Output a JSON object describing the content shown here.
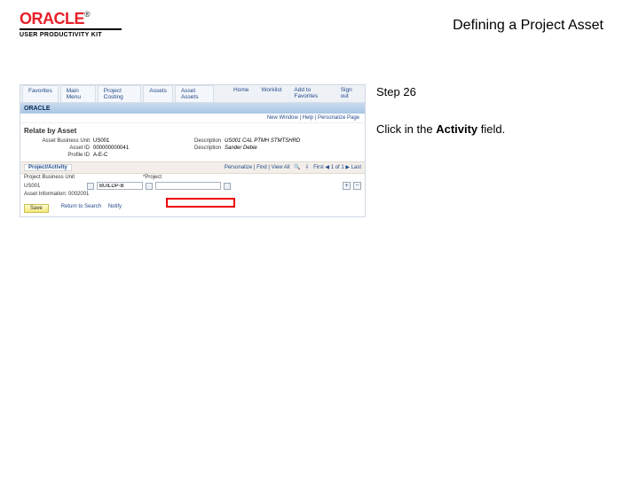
{
  "header": {
    "brand": "ORACLE",
    "brand_suffix": "®",
    "subbrand": "USER PRODUCTIVITY KIT",
    "doc_title": "Defining a Project Asset"
  },
  "instructions": {
    "step_label": "Step 26",
    "text_prefix": "Click in the ",
    "text_bold": "Activity",
    "text_suffix": " field."
  },
  "app": {
    "nav": [
      "Favorites",
      "Main Menu",
      "Project Costing",
      "Assets",
      "Asset Assets"
    ],
    "nav_right": [
      "Home",
      "Worklist",
      "Add to Favorites",
      "Sign out"
    ],
    "subbar_brand": "ORACLE",
    "util_links": "New Window | Help | Personalize Page",
    "section_title": "Relate by Asset",
    "fields": {
      "bu_label": "Asset Business Unit",
      "bu_value": "US001",
      "desc1_label": "Description",
      "desc1_value": "US001 CAL PTMH STMTSHRD",
      "assetid_label": "Asset ID",
      "assetid_value": "000000000041",
      "desc2_label": "Description",
      "desc2_value": "Sander Debie",
      "profile_label": "Profile ID",
      "profile_value": "A-E-C"
    },
    "grid": {
      "tab": "Project/Activity",
      "tools": "Personalize | Find | View All",
      "nav": "First ◀ 1 of 1 ▶ Last",
      "row1_label": "Project Business Unit",
      "row1_value": "",
      "row1b_label": "*Project",
      "row1b_value": "",
      "row2_label": "US001",
      "row2_field_value": "BUILDP-B",
      "activity_value": ""
    },
    "save_label": "Save",
    "ret_links": [
      "Return to Search",
      "Notify"
    ],
    "asset_row_label": "Asset Information:",
    "asset_row_value": "0002001"
  }
}
